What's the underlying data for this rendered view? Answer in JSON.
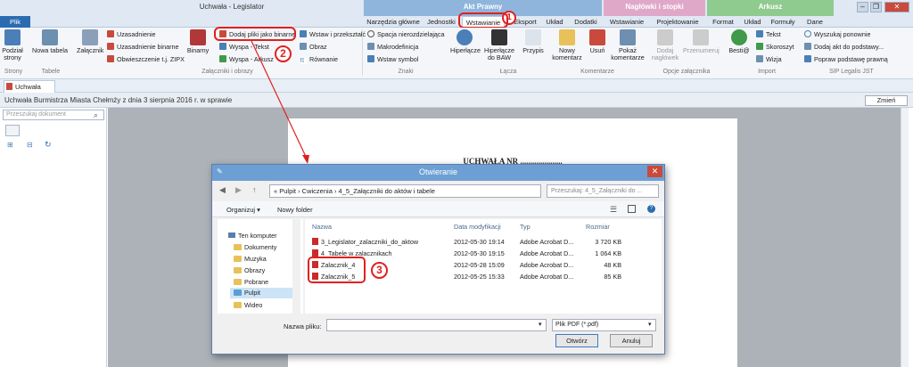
{
  "app": {
    "title": "Uchwała - Legislator"
  },
  "context_tabs": [
    {
      "label": "Akt Prawny",
      "color": "#8fb5dc"
    },
    {
      "label": "Nagłówki i stopki",
      "color": "#e0a8c8"
    },
    {
      "label": "Arkusz",
      "color": "#8fca8f"
    }
  ],
  "tabs": {
    "plik": "Plik",
    "narzedzia": "Narzędzia główne",
    "jednostki": "Jednostki",
    "wstawianie": "Wstawianie",
    "eksport": "Eksport",
    "uklad": "Układ",
    "dodatki": "Dodatki",
    "wstawianie2": "Wstawianie",
    "projektowanie": "Projektowanie",
    "format": "Format",
    "uklad2": "Układ",
    "formuly": "Formuły",
    "dane": "Dane"
  },
  "ribbon": {
    "podzial": "Podział strony",
    "nowa_tabela": "Nowa tabela",
    "zalacznik": "Załącznik",
    "uzasadnienie": "Uzasadnienie",
    "uzasadnienie_bin": "Uzasadnienie binarne",
    "obwieszczenie": "Obwieszczenie t.j. ZIPX",
    "binarny": "Binarny",
    "dodaj_pliki": "Dodaj pliki jako binarne",
    "wyspa_tekst": "Wyspa - Tekst",
    "wyspa_arkusz": "Wyspa - Arkusz",
    "wstaw_przeksztalc": "Wstaw i przekształć",
    "obraz": "Obraz",
    "rownanie": "Równanie",
    "spacja": "Spacja nierozdzielająca",
    "makrodefinicja": "Makrodefinicja",
    "wstaw_symbol": "Wstaw symbol",
    "hiperlacze": "Hiperłącze",
    "hiperlacze_baw": "Hiperłącze do BAW",
    "przypis": "Przypis",
    "nowy_komentarz": "Nowy komentarz",
    "usun": "Usuń",
    "pokaz_komentarze": "Pokaż komentarze",
    "dodaj_naglowek": "Dodaj nagłówek",
    "przenumeruj": "Przenumeruj",
    "besti": "Besti@",
    "tekst": "Tekst",
    "skoroszyt": "Skoroszyt",
    "wizja": "Wizja",
    "wyszukaj": "Wyszukaj ponownie",
    "dodaj_akt": "Dodaj akt do podstawy...",
    "popraw": "Popraw podstawę prawną",
    "g_strony": "Strony",
    "g_tabele": "Tabele",
    "g_zalaczniki": "Załączniki i obrazy",
    "g_znaki": "Znaki",
    "g_lacza": "Łącza",
    "g_komentarze": "Komentarze",
    "g_opcje": "Opcje załącznika",
    "g_import": "Import",
    "g_sip": "SIP Legalis JST"
  },
  "doc": {
    "tab": "Uchwała",
    "info": "Uchwała Burmistrza Miasta Chełmży z dnia 3 sierpnia 2016 r. w sprawie",
    "zmien": "Zmień",
    "search_placeholder": "Przeszukaj dokument",
    "heading": "UCHWAŁA NR ....................."
  },
  "dialog": {
    "title": "Otwieranie",
    "path": "«  Pulpit  ›  Cwiczenia  ›  4_5_Załączniki do aktów i tabele",
    "search": "Przeszukaj: 4_5_Załączniki do ...",
    "organizuj": "Organizuj ▾",
    "nowy_folder": "Nowy folder",
    "tree": [
      "Ten komputer",
      "Dokumenty",
      "Muzyka",
      "Obrazy",
      "Pobrane",
      "Pulpit",
      "Wideo"
    ],
    "columns": [
      "Nazwa",
      "Data modyfikacji",
      "Typ",
      "Rozmiar"
    ],
    "files": [
      {
        "name": "3_Legislator_zalaczniki_do_aktow",
        "date": "2012-05-30 19:14",
        "type": "Adobe Acrobat D...",
        "size": "3 720 KB"
      },
      {
        "name": "4_Tabele w zalacznikach",
        "date": "2012-05-30 19:15",
        "type": "Adobe Acrobat D...",
        "size": "1 064 KB"
      },
      {
        "name": "Zalacznik_4",
        "date": "2012-05-28 15:09",
        "type": "Adobe Acrobat D...",
        "size": "48 KB"
      },
      {
        "name": "Zalacznik_5",
        "date": "2012-05-25 15:33",
        "type": "Adobe Acrobat D...",
        "size": "85 KB"
      }
    ],
    "filename_label": "Nazwa pliku:",
    "filetype": "Plik PDF (*.pdf)",
    "open": "Otwórz",
    "cancel": "Anuluj"
  },
  "annotations": [
    "1",
    "2",
    "3"
  ]
}
